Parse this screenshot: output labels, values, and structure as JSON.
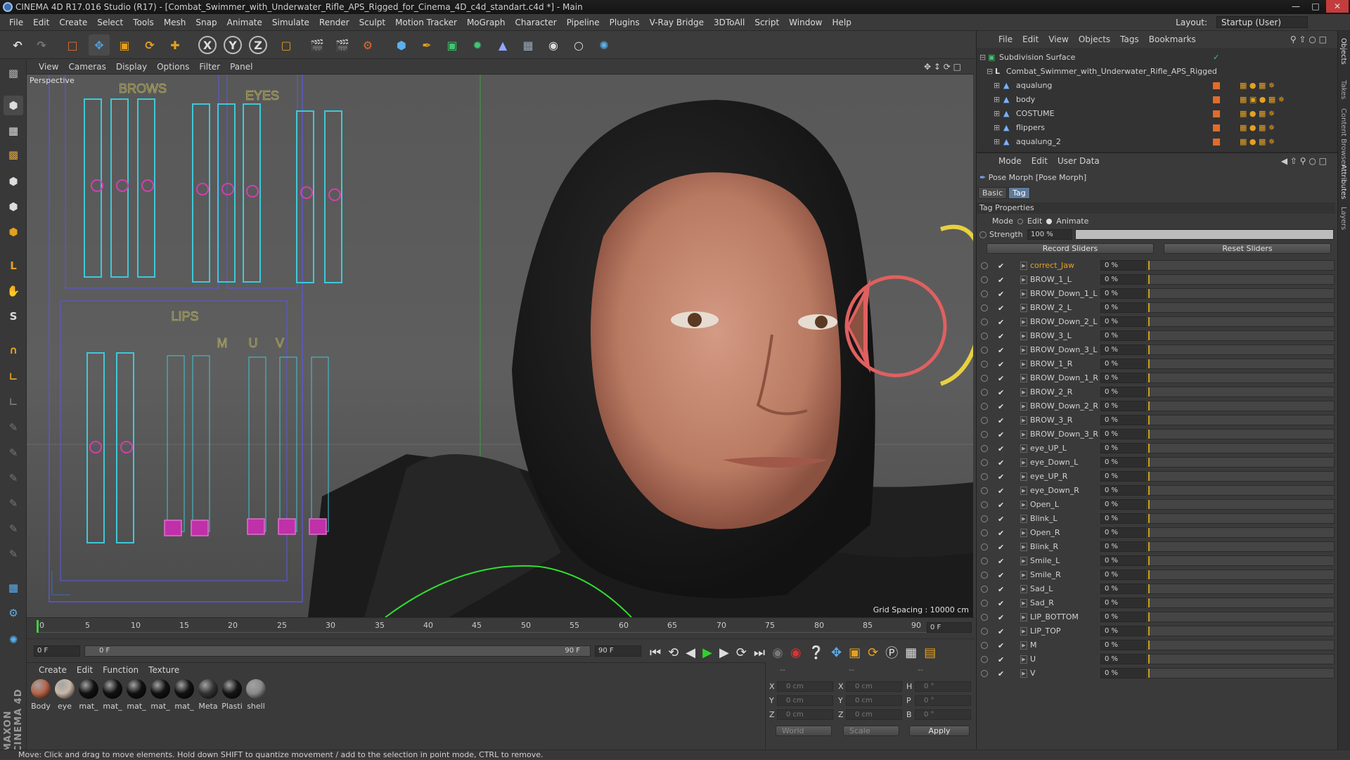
{
  "window": {
    "title": "CINEMA 4D R17.016 Studio (R17) - [Combat_Swimmer_with_Underwater_Rifle_APS_Rigged_for_Cinema_4D_c4d_standart.c4d *] - Main"
  },
  "menubar": {
    "items": [
      "File",
      "Edit",
      "Create",
      "Select",
      "Tools",
      "Mesh",
      "Snap",
      "Animate",
      "Simulate",
      "Render",
      "Sculpt",
      "Motion Tracker",
      "MoGraph",
      "Character",
      "Pipeline",
      "Plugins",
      "V-Ray Bridge",
      "3DToAll",
      "Script",
      "Window",
      "Help"
    ],
    "layout_label": "Layout:",
    "layout_value": "Startup (User)"
  },
  "viewport": {
    "menu": [
      "View",
      "Cameras",
      "Display",
      "Options",
      "Filter",
      "Panel"
    ],
    "name": "Perspective",
    "grid_spacing": "Grid Spacing : 10000 cm",
    "face_panel": {
      "title_brows": "BROWS",
      "title_eyes": "EYES",
      "title_lips": "LIPS",
      "letters": [
        "M",
        "U",
        "V"
      ]
    }
  },
  "timeline": {
    "ticks": [
      "0",
      "5",
      "10",
      "15",
      "20",
      "25",
      "30",
      "35",
      "40",
      "45",
      "50",
      "55",
      "60",
      "65",
      "70",
      "75",
      "80",
      "85",
      "90"
    ],
    "current": "0 F"
  },
  "transport": {
    "start": "0 F",
    "range_start": "0 F",
    "range_end": "90 F",
    "end": "90 F"
  },
  "materials": {
    "menu": [
      "Create",
      "Edit",
      "Function",
      "Texture"
    ],
    "items": [
      {
        "name": "Body",
        "color": "#b5654a"
      },
      {
        "name": "eye",
        "color": "#c8b8a8"
      },
      {
        "name": "mat_",
        "color": "#111111"
      },
      {
        "name": "mat_",
        "color": "#111111"
      },
      {
        "name": "mat_",
        "color": "#111111"
      },
      {
        "name": "mat_",
        "color": "#111111"
      },
      {
        "name": "mat_",
        "color": "#111111"
      },
      {
        "name": "Meta",
        "color": "#333333"
      },
      {
        "name": "Plasti",
        "color": "#151515"
      },
      {
        "name": "shell",
        "color": "#8a8a8a"
      }
    ]
  },
  "coords": {
    "header": [
      "--",
      "--",
      "--"
    ],
    "rows": [
      {
        "a": "X",
        "av": "0 cm",
        "b": "X",
        "bv": "0 cm",
        "c": "H",
        "cv": "0 °"
      },
      {
        "a": "Y",
        "av": "0 cm",
        "b": "Y",
        "bv": "0 cm",
        "c": "P",
        "cv": "0 °"
      },
      {
        "a": "Z",
        "av": "0 cm",
        "b": "Z",
        "bv": "0 cm",
        "c": "B",
        "cv": "0 °"
      }
    ],
    "space": "World",
    "mode": "Scale",
    "apply": "Apply"
  },
  "status": "Move: Click and drag to move elements. Hold down SHIFT to quantize movement / add to the selection in point mode, CTRL to remove.",
  "objects": {
    "menu": [
      "File",
      "Edit",
      "View",
      "Objects",
      "Tags",
      "Bookmarks"
    ],
    "items": [
      "Subdivision Surface",
      "Combat_Swimmer_with_Underwater_Rifle_APS_Rigged",
      "aqualung",
      "body",
      "COSTUME",
      "flippers",
      "aqualung_2"
    ]
  },
  "attributes": {
    "menu": [
      "Mode",
      "Edit",
      "User Data"
    ],
    "object": "Pose Morph [Pose Morph]",
    "tabs": [
      "Basic",
      "Tag"
    ],
    "section": "Tag Properties",
    "mode_label": "Mode",
    "mode_edit": "Edit",
    "mode_animate": "Animate",
    "strength_label": "Strength",
    "strength_value": "100 %",
    "strength": 1.0,
    "record": "Record Sliders",
    "reset": "Reset Sliders",
    "sliders": [
      {
        "name": "correct_Jaw",
        "value": "0 %"
      },
      {
        "name": "BROW_1_L",
        "value": "0 %"
      },
      {
        "name": "BROW_Down_1_L",
        "value": "0 %"
      },
      {
        "name": "BROW_2_L",
        "value": "0 %"
      },
      {
        "name": "BROW_Down_2_L",
        "value": "0 %"
      },
      {
        "name": "BROW_3_L",
        "value": "0 %"
      },
      {
        "name": "BROW_Down_3_L",
        "value": "0 %"
      },
      {
        "name": "BROW_1_R",
        "value": "0 %"
      },
      {
        "name": "BROW_Down_1_R",
        "value": "0 %"
      },
      {
        "name": "BROW_2_R",
        "value": "0 %"
      },
      {
        "name": "BROW_Down_2_R",
        "value": "0 %"
      },
      {
        "name": "BROW_3_R",
        "value": "0 %"
      },
      {
        "name": "BROW_Down_3_R",
        "value": "0 %"
      },
      {
        "name": "eye_UP_L",
        "value": "0 %"
      },
      {
        "name": "eye_Down_L",
        "value": "0 %"
      },
      {
        "name": "eye_UP_R",
        "value": "0 %"
      },
      {
        "name": "eye_Down_R",
        "value": "0 %"
      },
      {
        "name": "Open_L",
        "value": "0 %"
      },
      {
        "name": "Blink_L",
        "value": "0 %"
      },
      {
        "name": "Open_R",
        "value": "0 %"
      },
      {
        "name": "Blink_R",
        "value": "0 %"
      },
      {
        "name": "Smile_L",
        "value": "0 %"
      },
      {
        "name": "Smile_R",
        "value": "0 %"
      },
      {
        "name": "Sad_L",
        "value": "0 %"
      },
      {
        "name": "Sad_R",
        "value": "0 %"
      },
      {
        "name": "LIP_BOTTOM",
        "value": "0 %"
      },
      {
        "name": "LIP_TOP",
        "value": "0 %"
      },
      {
        "name": "M",
        "value": "0 %"
      },
      {
        "name": "U",
        "value": "0 %"
      },
      {
        "name": "V",
        "value": "0 %"
      }
    ]
  },
  "side_tabs": [
    "Objects",
    "Takes",
    "Content Browser",
    "Attributes",
    "Layers"
  ],
  "brand": "MAXON CINEMA 4D"
}
